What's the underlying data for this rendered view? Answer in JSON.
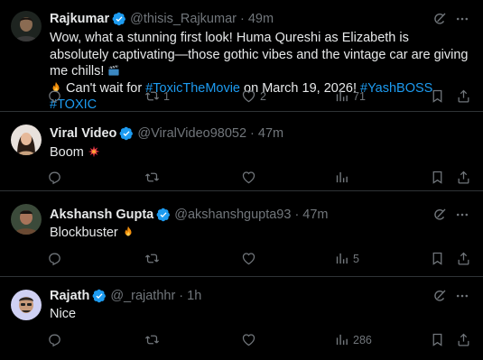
{
  "tweets": [
    {
      "name": "Rajkumar",
      "handle": "@thisis_Rajkumar",
      "time": "49m",
      "text_part1": "Wow, what a stunning first look! Huma Qureshi as Elizabeth is absolutely captivating—those gothic vibes and the vintage car are giving me chills!",
      "text_part2": "Can't wait for",
      "hashtag1": "#ToxicTheMovie",
      "text_part3": "on March 19, 2026!",
      "hashtag2": "#YashBOSS",
      "hashtag3": "#TOXIC",
      "retweets": "1",
      "likes": "2",
      "views": "71",
      "avatar_color": "#2b2b2b"
    },
    {
      "name": "Viral Video",
      "handle": "@ViralVideo98052",
      "time": "47m",
      "text": "Boom",
      "retweets": "",
      "likes": "",
      "views": "",
      "avatar_color": "#d9b59a"
    },
    {
      "name": "Akshansh Gupta",
      "handle": "@akshanshgupta93",
      "time": "47m",
      "text": "Blockbuster",
      "retweets": "",
      "likes": "",
      "views": "5",
      "avatar_color": "#7a5a45"
    },
    {
      "name": "Rajath",
      "handle": "@_rajathhr",
      "time": "1h",
      "text": "Nice",
      "retweets": "",
      "likes": "",
      "views": "286",
      "avatar_color": "#d6d7f5"
    }
  ],
  "dot": "·",
  "colors": {
    "accent": "#1d9bf0",
    "muted": "#71767b",
    "text": "#e7e9ea",
    "border": "#2f3336"
  },
  "icons": [
    "verified-badge-icon",
    "grok-icon",
    "more-icon",
    "reply-icon",
    "retweet-icon",
    "like-icon",
    "views-icon",
    "fire-emoji-icon",
    "clapper-emoji-icon",
    "collision-emoji-icon"
  ]
}
